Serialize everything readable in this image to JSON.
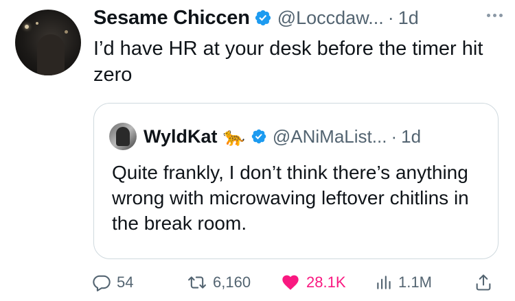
{
  "tweet": {
    "author_name": "Sesame Chiccen",
    "handle": "@Loccdaw...",
    "separator": "·",
    "time": "1d",
    "text": "I’d have HR at your desk before the timer hit zero"
  },
  "quoted": {
    "author_name": "WyldKat",
    "emoji": "🐆",
    "handle": "@ANiMaList...",
    "separator": "·",
    "time": "1d",
    "text": "Quite frankly, I don’t think there’s anything wrong with microwaving leftover chitlins in the break room."
  },
  "actions": {
    "replies": "54",
    "retweets": "6,160",
    "likes": "28.1K",
    "views": "1.1M"
  },
  "colors": {
    "verified": "#1d9bf0",
    "like": "#f91880",
    "muted": "#536471",
    "border": "#cfd9de"
  },
  "icons": [
    "more-icon",
    "verified-icon",
    "reply-icon",
    "retweet-icon",
    "like-icon",
    "views-icon",
    "share-icon"
  ]
}
